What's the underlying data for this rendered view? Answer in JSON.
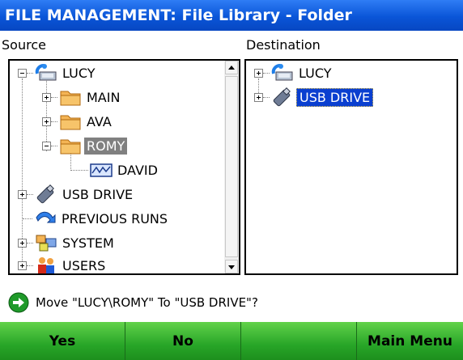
{
  "title": "FILE MANAGEMENT: File Library - Folder",
  "source": {
    "label": "Source",
    "tree": [
      {
        "label": "LUCY",
        "icon": "computer-icon",
        "expander": "minus"
      },
      {
        "label": "MAIN",
        "icon": "folder-icon",
        "expander": "plus"
      },
      {
        "label": "AVA",
        "icon": "folder-icon",
        "expander": "plus"
      },
      {
        "label": "ROMY",
        "icon": "folder-icon",
        "expander": "minus",
        "selected": true
      },
      {
        "label": "DAVID",
        "icon": "run-data-icon"
      },
      {
        "label": "USB DRIVE",
        "icon": "usb-drive-icon",
        "expander": "plus"
      },
      {
        "label": "PREVIOUS RUNS",
        "icon": "arrow-icon"
      },
      {
        "label": "SYSTEM",
        "icon": "system-icon",
        "expander": "plus"
      },
      {
        "label": "USERS",
        "icon": "users-icon",
        "expander": "plus"
      }
    ]
  },
  "destination": {
    "label": "Destination",
    "tree": [
      {
        "label": "LUCY",
        "icon": "computer-icon",
        "expander": "plus"
      },
      {
        "label": "USB DRIVE",
        "icon": "usb-drive-icon",
        "expander": "plus",
        "selected": true
      }
    ]
  },
  "confirm": {
    "icon": "green-arrow-icon",
    "text": "Move \"LUCY\\ROMY\" To \"USB DRIVE\"?"
  },
  "buttons": {
    "yes": "Yes",
    "no": "No",
    "blank": "",
    "main_menu": "Main Menu"
  },
  "colors": {
    "title_bar": "#0a55d8",
    "button_green": "#28a628",
    "selection_blue": "#0a3fd0",
    "selection_gray": "#808080"
  }
}
